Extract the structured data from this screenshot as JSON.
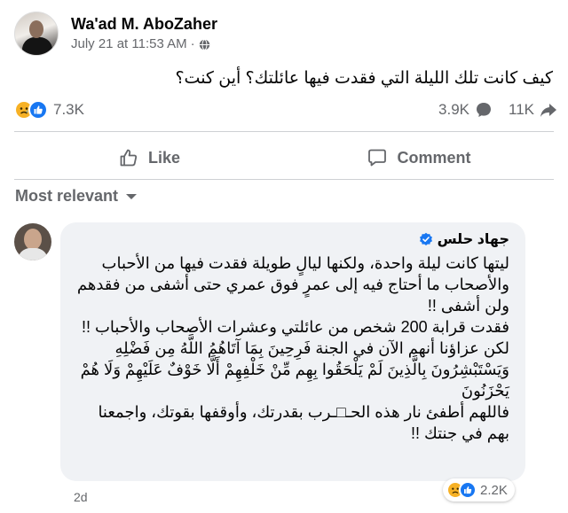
{
  "post": {
    "author": "Wa'ad M. AboZaher",
    "timestamp": "July 21 at 11:53 AM",
    "separator": "·",
    "audience_icon": "globe-icon",
    "text": "كيف كانت تلك الليلة التي فقدت فيها عائلتك؟ أين كنت؟"
  },
  "stats": {
    "reaction_icons": [
      "sad-reaction-icon",
      "like-reaction-icon"
    ],
    "reaction_count": "7.3K",
    "comments_count": "3.9K",
    "shares_count": "11K"
  },
  "actions": {
    "like_label": "Like",
    "comment_label": "Comment"
  },
  "sort": {
    "label": "Most relevant"
  },
  "comment": {
    "author": "جهاد حلس",
    "verified": true,
    "text": "ليتها كانت ليلة واحدة، ولكنها ليالٍ طويلة فقدت فيها من الأحباب والأصحاب ما أحتاج فيه إلى عمرٍ فوق عمري حتى أشفى من فقدهم ولن أشفى !!\nفقدت قرابة 200 شخص من عائلتي وعشرات الأصحاب والأحباب !!\nلكن عزاؤنا أنهم الآن في الجنة فَرِحِينَ بِمَا آتَاهُمُ اللَّهُ مِن فَضْلِهِ وَيَسْتَبْشِرُونَ بِالَّذِينَ لَمْ يَلْحَقُوا بِهِم مِّنْ خَلْفِهِمْ أَلَّا خَوْفٌ عَلَيْهِمْ وَلَا هُمْ يَحْزَنُونَ\nفاللهم أطفئ نار هذه الحـ□ـرب بقدرتك، وأوقفها بقوتك، واجمعنا بهم في جنتك !!",
    "reaction_count": "2.2K",
    "time": "2d"
  },
  "colors": {
    "like_blue": "#1877f2",
    "sad_yellow": "#f7b125",
    "secondary_text": "#65676b",
    "bubble_bg": "#f0f2f5"
  }
}
